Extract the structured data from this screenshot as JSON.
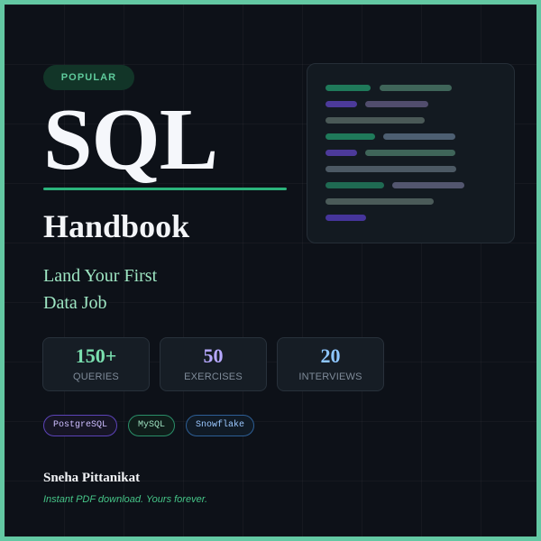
{
  "book": {
    "badge": "POPULAR",
    "title": "SQL",
    "subtitle": "Handbook",
    "tagline_line1": "Land Your First",
    "tagline_line2": "Data Job",
    "author": "Sneha Pittanikat",
    "footer_note": "Instant PDF download. Yours forever."
  },
  "stats": [
    {
      "value": "150+",
      "label": "QUERIES",
      "color": "#7be0b0"
    },
    {
      "value": "50",
      "label": "EXERCISES",
      "color": "#b7a9ff"
    },
    {
      "value": "20",
      "label": "INTERVIEWS",
      "color": "#8ec6ff"
    }
  ],
  "tags": [
    {
      "label": "PostgreSQL",
      "color": "#cdbdff",
      "border": "#5c43b8",
      "bg": "#161525"
    },
    {
      "label": "MySQL",
      "color": "#9de0bf",
      "border": "#2a8f69",
      "bg": "#0f1d1a"
    },
    {
      "label": "Snowflake",
      "color": "#9bc8ff",
      "border": "#2d5f96",
      "bg": "#101a25"
    }
  ],
  "code_lines": [
    {
      "color": "#1f7a5a"
    },
    {
      "color": "#3f6559"
    },
    {
      "color": "#4c3a9a"
    },
    {
      "color": "#514d6d"
    },
    {
      "color": "#4a5957"
    },
    {
      "color": "#1f7a5a"
    },
    {
      "color": "#4d5f72"
    },
    {
      "color": "#4c3a9a"
    },
    {
      "color": "#3f6559"
    },
    {
      "color": "#4c5964"
    },
    {
      "color": "#1f6a52"
    },
    {
      "color": "#53566f"
    },
    {
      "color": "#4b5b59"
    },
    {
      "color": "#46359b"
    }
  ],
  "colors": {
    "background": "#0d1118",
    "border": "#63c8a3",
    "accent": "#2bb47c"
  }
}
